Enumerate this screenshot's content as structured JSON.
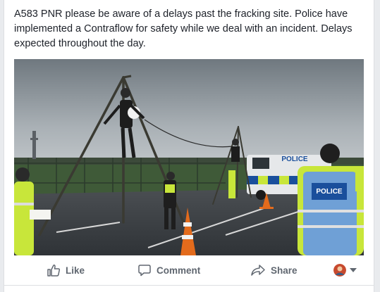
{
  "post": {
    "text": "A583 PNR please be aware of a delays past the fracking site. Police have implemented a Contraflow for safety while we deal with an incident. Delays expected throughout the day.",
    "photo": {
      "van_label": "POLICE",
      "vest_label": "POLICE"
    }
  },
  "actions": {
    "like_label": "Like",
    "comment_label": "Comment",
    "share_label": "Share"
  },
  "colors": {
    "text": "#1d2129",
    "action_text": "#606770",
    "divider": "#dddfe2",
    "hi_vis": "#c8e63a",
    "police_blue": "#1a4f9c"
  },
  "icons": {
    "like": "thumbs-up-icon",
    "comment": "speech-bubble-icon",
    "share": "share-arrow-icon",
    "audience_caret": "chevron-down-icon"
  }
}
